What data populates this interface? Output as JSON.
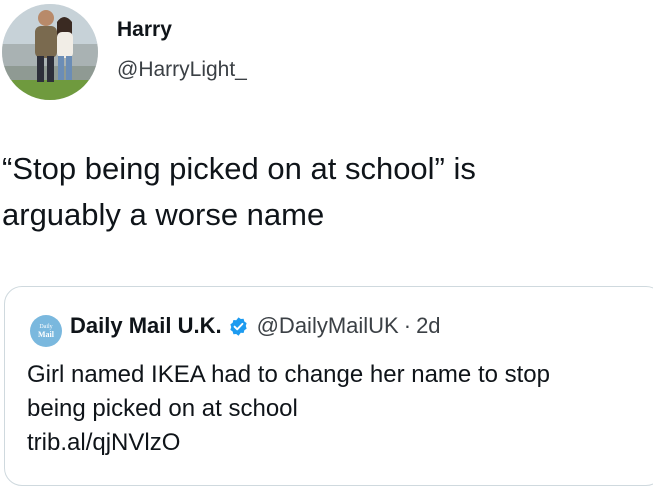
{
  "tweet": {
    "author": {
      "display_name": "Harry",
      "handle": "@HarryLight_",
      "avatar_icon": "profile-photo"
    },
    "text": "“Stop being picked on at school” is\narguably a worse name",
    "quoted": {
      "author": {
        "display_name": "Daily Mail U.K.",
        "handle": "@DailyMailUK",
        "separator": "·",
        "time": "2d",
        "avatar_icon": "daily-mail-logo",
        "logo_text_top": "Daily",
        "logo_text_main": "Mail",
        "verified": true,
        "verified_color": "#1d9bf0"
      },
      "text_lines": [
        "Girl named IKEA had to change her name to stop",
        "being picked on at school"
      ],
      "link": "trib.al/qjNVlzO"
    }
  }
}
